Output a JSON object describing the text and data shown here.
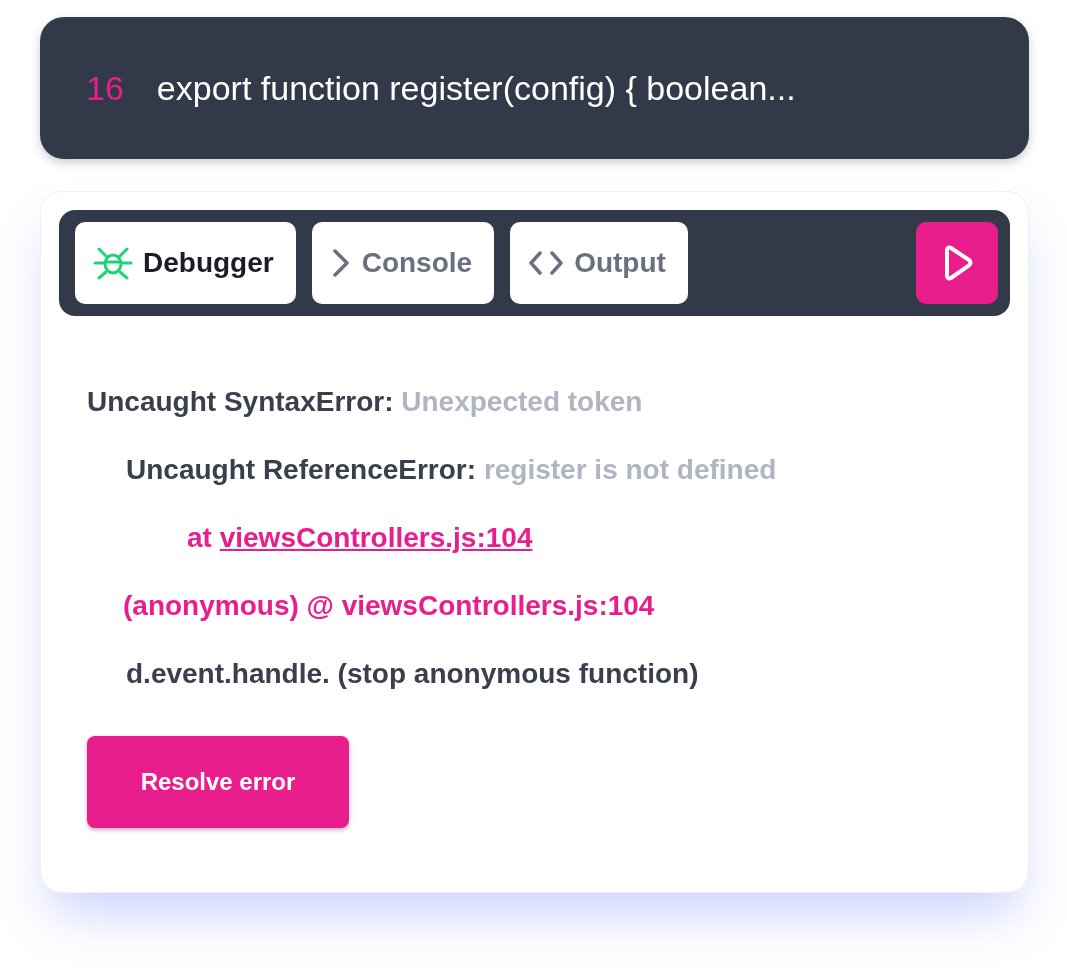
{
  "code_line": {
    "line_number": "16",
    "text": "export function register(config) { boolean..."
  },
  "tabs": [
    {
      "label": "Debugger",
      "kind": "debugger",
      "selected": true
    },
    {
      "label": "Console",
      "kind": "console",
      "selected": false
    },
    {
      "label": "Output",
      "kind": "output",
      "selected": false
    }
  ],
  "log": [
    {
      "kind": "error",
      "label": "Uncaught SyntaxError:",
      "detail": "Unexpected token",
      "children": [
        {
          "kind": "error",
          "label": "Uncaught ReferenceError:",
          "detail": "register is not defined",
          "children": [
            {
              "kind": "location",
              "prefix": "at",
              "link": "viewsControllers.js:104"
            }
          ]
        },
        {
          "kind": "frame",
          "text": "(anonymous) @ viewsControllers.js:104"
        },
        {
          "kind": "plain",
          "text": "d.event.handle. (stop anonymous function)"
        }
      ]
    }
  ],
  "resolve_button": "Resolve error"
}
